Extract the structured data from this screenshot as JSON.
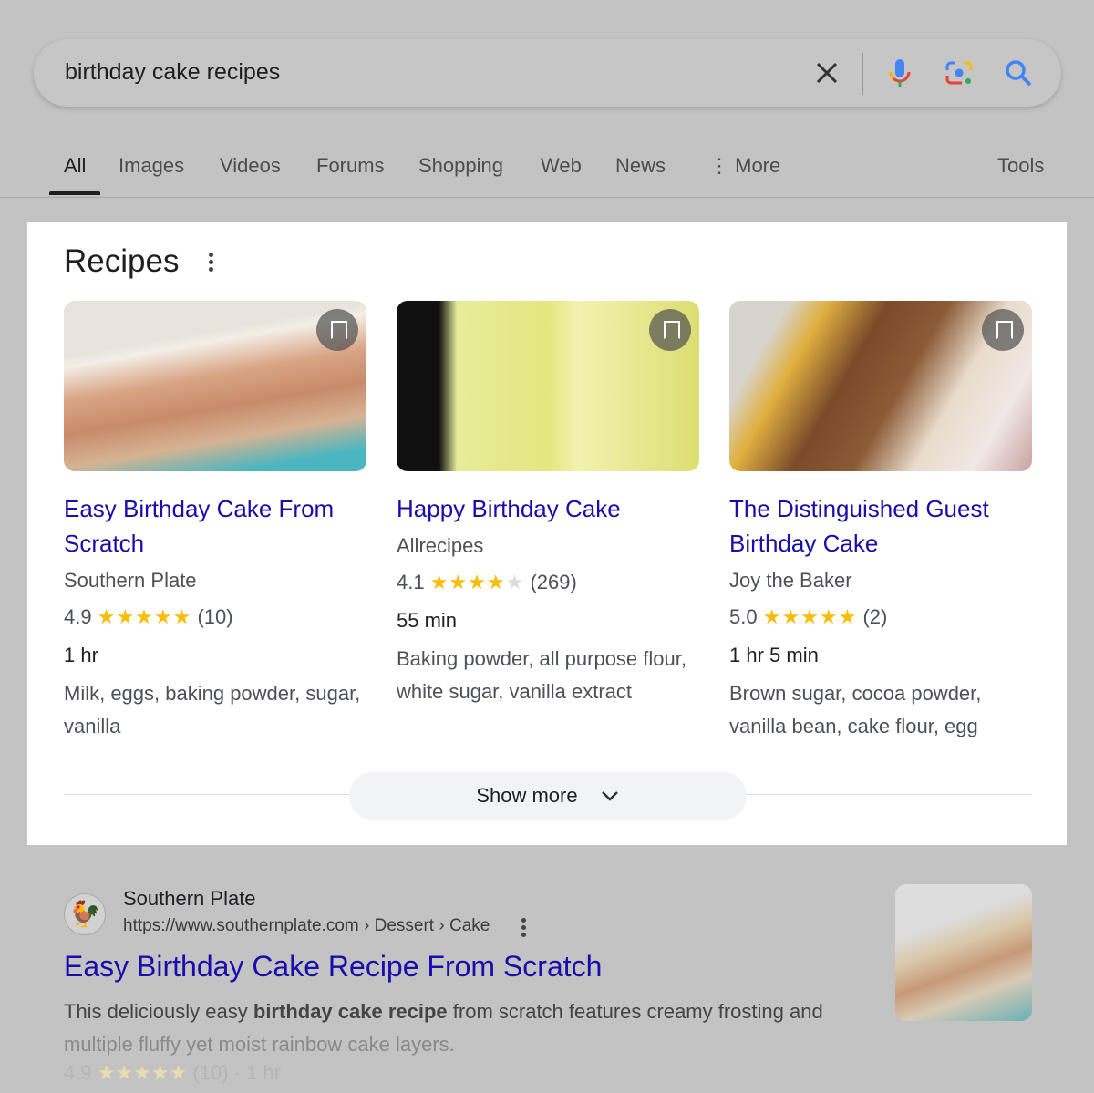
{
  "search": {
    "query": "birthday cake recipes",
    "icons": [
      "close-icon",
      "microphone-icon",
      "lens-camera-icon",
      "search-icon"
    ]
  },
  "tabs": [
    {
      "label": "All"
    },
    {
      "label": "Images"
    },
    {
      "label": "Videos"
    },
    {
      "label": "Forums"
    },
    {
      "label": "Shopping"
    },
    {
      "label": "Web"
    },
    {
      "label": "News"
    },
    {
      "label": "More"
    }
  ],
  "tools_label": "Tools",
  "recipes": {
    "heading": "Recipes",
    "show_more": "Show more",
    "cards": [
      {
        "title": "Easy Birthday Cake From Scratch",
        "source": "Southern Plate",
        "rating": "4.9",
        "stars": 5,
        "count": "(10)",
        "time": "1 hr",
        "ingredients": "Milk, eggs, baking powder, sugar, vanilla"
      },
      {
        "title": "Happy Birthday Cake",
        "source": "Allrecipes",
        "rating": "4.1",
        "stars": 4,
        "count": "(269)",
        "time": "55 min",
        "ingredients": "Baking powder, all purpose flour, white sugar, vanilla extract"
      },
      {
        "title": "The Distinguished Guest Birthday Cake",
        "source": "Joy the Baker",
        "rating": "5.0",
        "stars": 5,
        "count": "(2)",
        "time": "1 hr 5 min",
        "ingredients": "Brown sugar, cocoa powder, vanilla bean, cake flour, egg"
      }
    ]
  },
  "result": {
    "site": "Southern Plate",
    "url": "https://www.southernplate.com › Dessert › Cake",
    "title": "Easy Birthday Cake Recipe From Scratch",
    "snippet_pre": "This deliciously easy ",
    "snippet_bold": "birthday cake recipe",
    "snippet_post": " from scratch features creamy frosting and",
    "snippet_line2": "multiple fluffy yet moist rainbow cake layers.",
    "rating": "4.9",
    "count": "(10)",
    "time": "· 1 hr"
  },
  "colors": {
    "link": "#1a0dab",
    "star": "#fbbc04"
  }
}
